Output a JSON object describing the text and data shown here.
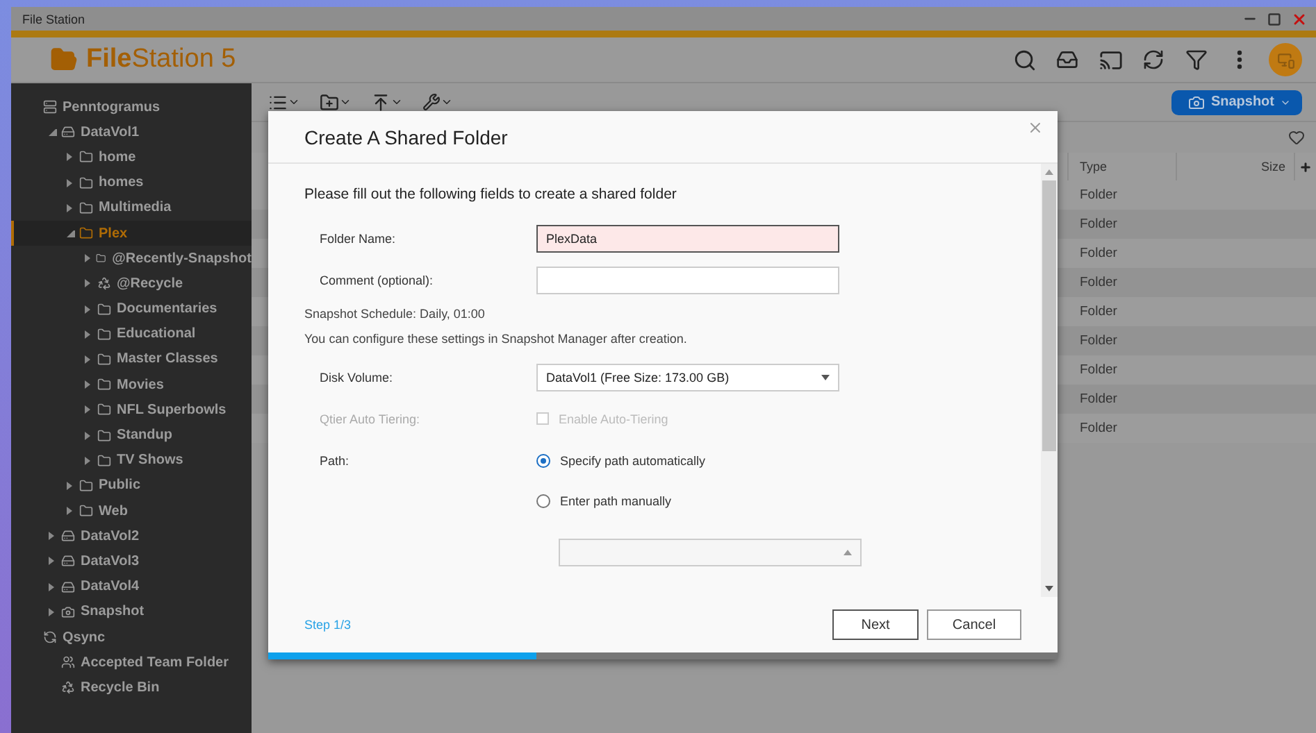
{
  "window": {
    "title": "File Station"
  },
  "app": {
    "logo": "**File**Station 5"
  },
  "toolbar": {
    "snapshot_button": "Snapshot"
  },
  "sidebar": {
    "tree": [
      {
        "label": "Penntogramus",
        "kind": "nas",
        "selected": false,
        "children": [
          {
            "label": "DataVol1",
            "kind": "volume",
            "expanded": true,
            "selected": false,
            "children": [
              {
                "label": "home",
                "kind": "folder",
                "expanded": false,
                "selected": false
              },
              {
                "label": "homes",
                "kind": "folder",
                "expanded": false,
                "selected": false
              },
              {
                "label": "Multimedia",
                "kind": "folder",
                "expanded": false,
                "selected": false
              },
              {
                "label": "Plex",
                "kind": "folder",
                "expanded": true,
                "selected": true,
                "children": [
                  {
                    "label": "@Recently-Snapshot",
                    "kind": "folder",
                    "expanded": false,
                    "selected": false
                  },
                  {
                    "label": "@Recycle",
                    "kind": "recycle",
                    "expanded": false,
                    "selected": false
                  },
                  {
                    "label": "Documentaries",
                    "kind": "folder",
                    "expanded": false,
                    "selected": false
                  },
                  {
                    "label": "Educational",
                    "kind": "folder",
                    "expanded": false,
                    "selected": false
                  },
                  {
                    "label": "Master Classes",
                    "kind": "folder",
                    "expanded": false,
                    "selected": false
                  },
                  {
                    "label": "Movies",
                    "kind": "folder",
                    "expanded": false,
                    "selected": false
                  },
                  {
                    "label": "NFL Superbowls",
                    "kind": "folder",
                    "expanded": false,
                    "selected": false
                  },
                  {
                    "label": "Standup",
                    "kind": "folder",
                    "expanded": false,
                    "selected": false
                  },
                  {
                    "label": "TV Shows",
                    "kind": "folder",
                    "expanded": false,
                    "selected": false
                  }
                ]
              },
              {
                "label": "Public",
                "kind": "folder",
                "expanded": false,
                "selected": false
              },
              {
                "label": "Web",
                "kind": "folder",
                "expanded": false,
                "selected": false
              }
            ]
          },
          {
            "label": "DataVol2",
            "kind": "volume",
            "expanded": false,
            "selected": false
          },
          {
            "label": "DataVol3",
            "kind": "volume",
            "expanded": false,
            "selected": false
          },
          {
            "label": "DataVol4",
            "kind": "volume",
            "expanded": false,
            "selected": false
          },
          {
            "label": "Snapshot",
            "kind": "snapshot",
            "expanded": false,
            "selected": false
          }
        ]
      },
      {
        "label": "Qsync",
        "kind": "qsync",
        "selected": false,
        "children": [
          {
            "label": "Accepted Team Folder",
            "kind": "team",
            "selected": false
          },
          {
            "label": "Recycle Bin",
            "kind": "recycle",
            "selected": false
          }
        ]
      }
    ]
  },
  "table": {
    "columns": [
      "Type",
      "Size"
    ],
    "rows": [
      {
        "type": "Folder"
      },
      {
        "type": "Folder"
      },
      {
        "type": "Folder"
      },
      {
        "type": "Folder"
      },
      {
        "type": "Folder"
      },
      {
        "type": "Folder"
      },
      {
        "type": "Folder"
      },
      {
        "type": "Folder"
      },
      {
        "type": "Folder"
      }
    ]
  },
  "dialog": {
    "title": "Create A Shared Folder",
    "intro": "Please fill out the following fields to create a shared folder",
    "folder_name": {
      "label": "Folder Name:",
      "value": "PlexData"
    },
    "comment": {
      "label": "Comment (optional):"
    },
    "notes": [
      "Snapshot Schedule: Daily, 01:00",
      "You can configure these settings in Snapshot Manager after creation."
    ],
    "disk_volume": {
      "label": "Disk Volume:",
      "value": "DataVol1 (Free Size: 173.00 GB)"
    },
    "auto_tiering": {
      "label": "Qtier Auto Tiering:",
      "option": "Enable Auto-Tiering",
      "checked": false,
      "disabled": true
    },
    "path": {
      "label": "Path:",
      "options": [
        {
          "label": "Specify path automatically",
          "selected": true
        },
        {
          "label": "Enter path manually",
          "selected": false
        }
      ]
    },
    "step": "Step 1/3",
    "progress": {
      "level": 0.34
    },
    "buttons": [
      "Next",
      "Cancel"
    ]
  }
}
